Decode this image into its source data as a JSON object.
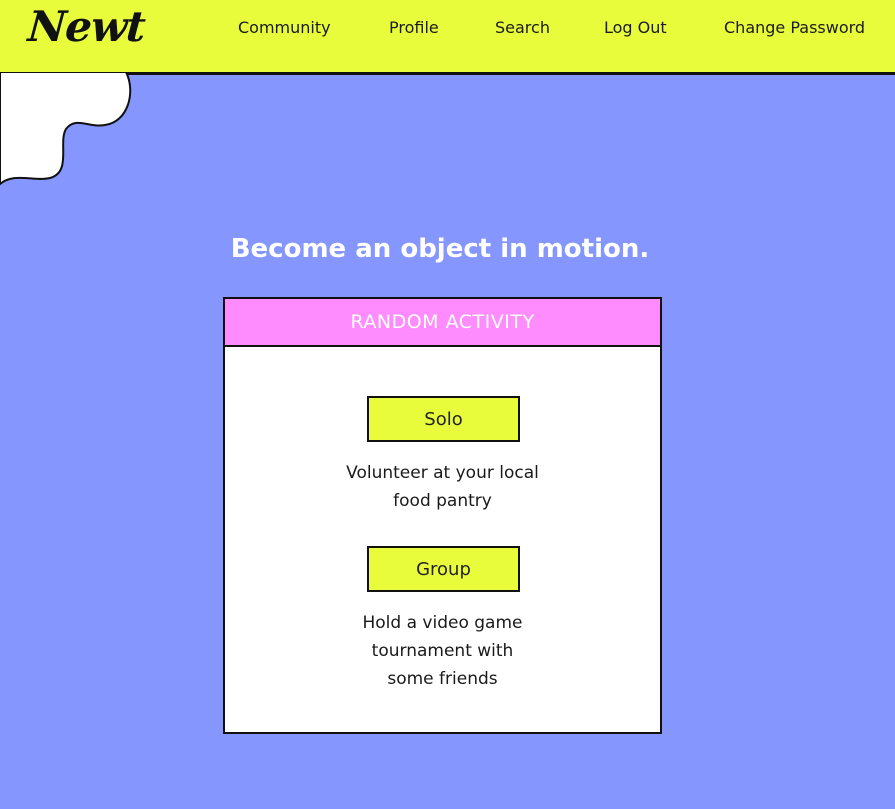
{
  "brand": {
    "logo_text": "Newt"
  },
  "nav": {
    "community": "Community",
    "profile": "Profile",
    "search": "Search",
    "logout": "Log Out",
    "change_password": "Change Password"
  },
  "main": {
    "headline": "Become an object in motion.",
    "card": {
      "title": "RANDOM ACTIVITY",
      "solo": {
        "button_label": "Solo",
        "activity_line1": "Volunteer at your local",
        "activity_line2": "food pantry"
      },
      "group": {
        "button_label": "Group",
        "activity_line1": "Hold a video game",
        "activity_line2": "tournament with",
        "activity_line3": "some friends"
      }
    }
  },
  "colors": {
    "background": "#8696ff",
    "header": "#e8fc3c",
    "card_header": "#ff8cff",
    "button": "#e8fc3c"
  }
}
